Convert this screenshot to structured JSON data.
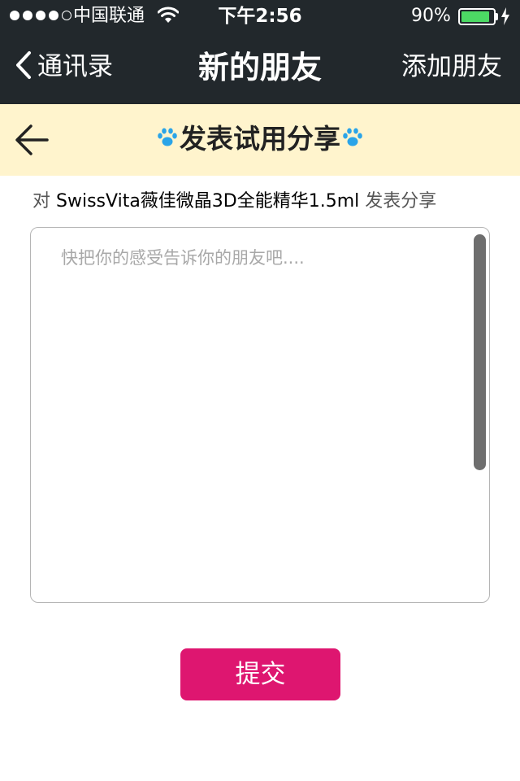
{
  "status_bar": {
    "carrier": "中国联通",
    "time": "下午2:56",
    "battery": "90%",
    "battery_level": 0.9,
    "signal_bars_filled": 4,
    "signal_bars_total": 5
  },
  "nav": {
    "back_label": "通讯录",
    "title": "新的朋友",
    "right_action": "添加朋友"
  },
  "page": {
    "title": "发表试用分享"
  },
  "subject": {
    "prefix": "对",
    "product": "SwissVita薇佳微晶3D全能精华1.5ml",
    "suffix": "发表分享"
  },
  "share_input": {
    "placeholder": "快把你的感受告诉你的朋友吧....",
    "value": ""
  },
  "submit_label": "提交",
  "colors": {
    "bar_background": "#22282c",
    "header_background": "#fff4cd",
    "accent": "#de1670",
    "paw_icon": "#2aa4e8",
    "battery_fill": "#4cd964"
  }
}
